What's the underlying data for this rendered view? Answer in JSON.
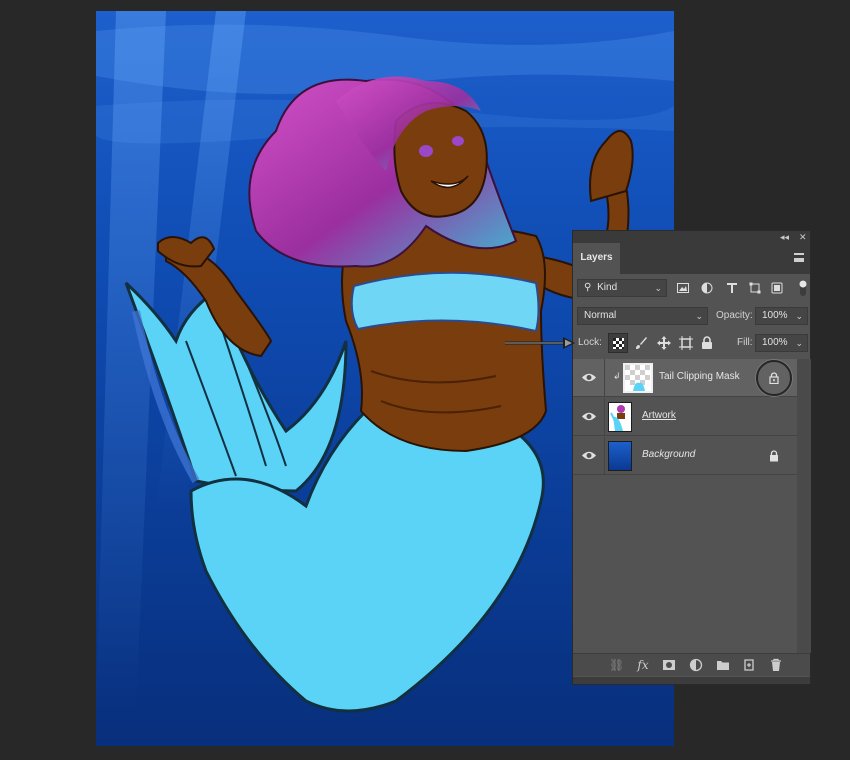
{
  "panel": {
    "tab_label": "Layers",
    "collapse_glyph": "◂◂",
    "close_glyph": "✕",
    "menu_icon": "hamburger-menu-icon"
  },
  "filter": {
    "kind_label": "Kind",
    "icons": [
      "image-filter-icon",
      "adjustment-filter-icon",
      "type-filter-icon",
      "shape-filter-icon",
      "smart-object-filter-icon"
    ]
  },
  "blend": {
    "mode": "Normal",
    "opacity_label": "Opacity:",
    "opacity_value": "100%"
  },
  "lock": {
    "label": "Lock:",
    "fill_label": "Fill:",
    "fill_value": "100%",
    "icons": [
      "lock-transparent-pixels-icon",
      "lock-image-pixels-icon",
      "lock-position-icon",
      "lock-artboard-icon",
      "lock-all-icon"
    ]
  },
  "layers": [
    {
      "name": "Tail Clipping Mask",
      "visible": true,
      "selected": true,
      "clipped": true,
      "locked": true
    },
    {
      "name": "Artwork",
      "visible": true,
      "selected": false,
      "clipped": false,
      "locked": false
    },
    {
      "name": "Background",
      "visible": true,
      "selected": false,
      "clipped": false,
      "locked": true
    }
  ],
  "bottom_icons": [
    "link-layers-icon",
    "fx-icon",
    "add-mask-icon",
    "adjustment-layer-icon",
    "new-group-icon",
    "new-layer-icon",
    "delete-layer-icon"
  ],
  "colors": {
    "app_bg": "#282828",
    "panel_bg": "#535353",
    "selected_row": "#626262",
    "ocean": "#0f4cb3",
    "tail": "#5ad3f7",
    "hair": "#b03ab0",
    "skin": "#7a3d0e"
  }
}
